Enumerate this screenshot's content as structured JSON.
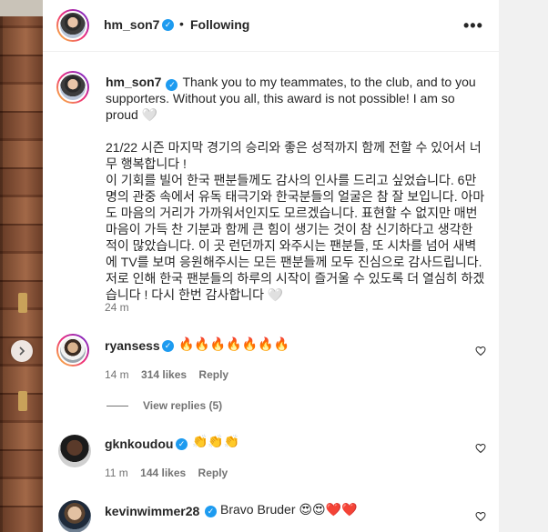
{
  "post": {
    "author": "hm_son7",
    "follow_status": "Following",
    "separator": "•",
    "more_label": "•••"
  },
  "caption": {
    "username": "hm_son7",
    "text": "Thank you to my teammates, to the club, and to you supporters. Without you all, this award is not possible! I am so proud 🤍\n\n21/22 시즌 마지막 경기의 승리와 좋은 성적까지 함께 전할 수 있어서 너무 행복합니다 !\n이 기회를 빌어 한국 팬분들께도 감사의 인사를 드리고 싶었습니다. 6만명의 관중 속에서 유독 태극기와 한국분들의 얼굴은 참 잘 보입니다. 아마도 마음의 거리가 가까워서인지도 모르겠습니다. 표현할 수 없지만 매번 마음이 가득 찬 기분과 함께 큰 힘이 생기는 것이 참 신기하다고 생각한 적이 많았습니다. 이 곳 런던까지 와주시는 팬분들, 또 시차를 넘어 새벽에 TV를 보며 응원해주시는 모든 팬분들께 모두 진심으로 감사드립니다. 저로 인해 한국 팬분들의 하루의 시작이 즐거울 수 있도록 더 열심히 하겠습니다 ! 다시 한번 감사합니다 🤍",
    "time": "24 m"
  },
  "comments": [
    {
      "username": "ryansess",
      "text": "🔥🔥🔥🔥🔥🔥🔥",
      "time": "14 m",
      "likes": "314 likes",
      "reply_label": "Reply",
      "view_replies": "View replies (5)"
    },
    {
      "username": "gknkoudou",
      "text": "👏👏👏",
      "time": "11 m",
      "likes": "144 likes",
      "reply_label": "Reply"
    },
    {
      "username": "kevinwimmer28",
      "text": "Bravo Bruder 😍😍❤️❤️"
    }
  ],
  "icons": {
    "verified": "verified-badge-icon",
    "heart": "heart-outline-icon",
    "more": "more-options-icon",
    "nav": "chevron-right-icon"
  },
  "colors": {
    "verified": "#1d9bf0",
    "meta_text": "#737373",
    "primary_text": "#262626"
  }
}
